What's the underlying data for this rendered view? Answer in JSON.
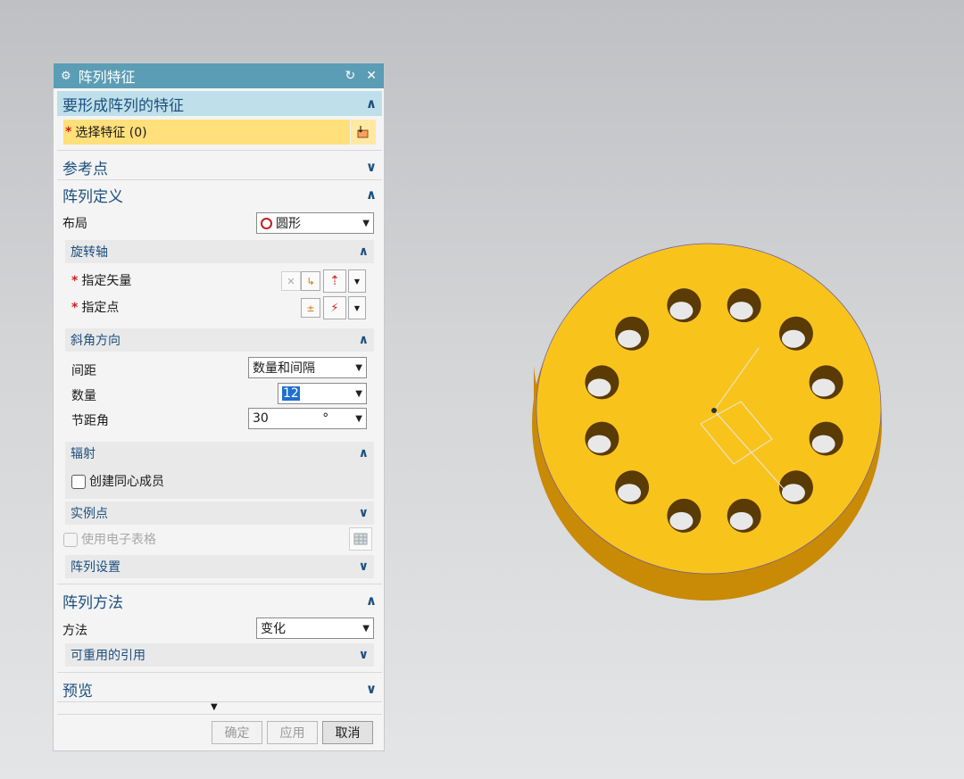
{
  "dialog": {
    "title": "阵列特征",
    "sections": {
      "feature_to_pattern": {
        "label": "要形成阵列的特征"
      },
      "reference_point": {
        "label": "参考点"
      },
      "pattern_definition": {
        "label": "阵列定义"
      },
      "pattern_method": {
        "label": "阵列方法"
      },
      "preview": {
        "label": "预览"
      }
    },
    "select_feature": {
      "label": "选择特征 (0)"
    },
    "layout": {
      "label": "布局",
      "value": "圆形"
    },
    "rotation_axis": {
      "label": "旋转轴",
      "specify_vector": "指定矢量",
      "specify_point": "指定点"
    },
    "angular_direction": {
      "label": "斜角方向",
      "spacing_label": "间距",
      "spacing_value": "数量和间隔",
      "count_label": "数量",
      "count_value": "12",
      "pitch_label": "节距角",
      "pitch_value": "30",
      "pitch_unit": "°"
    },
    "radiate": {
      "label": "辐射",
      "create_concentric": "创建同心成员"
    },
    "instance_points": {
      "label": "实例点"
    },
    "use_spreadsheet": {
      "label": "使用电子表格"
    },
    "pattern_settings": {
      "label": "阵列设置"
    },
    "method": {
      "label": "方法",
      "value": "变化"
    },
    "reusable_refs": {
      "label": "可重用的引用"
    },
    "buttons": {
      "ok": "确定",
      "apply": "应用",
      "cancel": "取消"
    }
  },
  "model": {
    "colors": {
      "face": "#f8c41c",
      "side": "#c98a05",
      "hole": "#5a3a05"
    }
  }
}
